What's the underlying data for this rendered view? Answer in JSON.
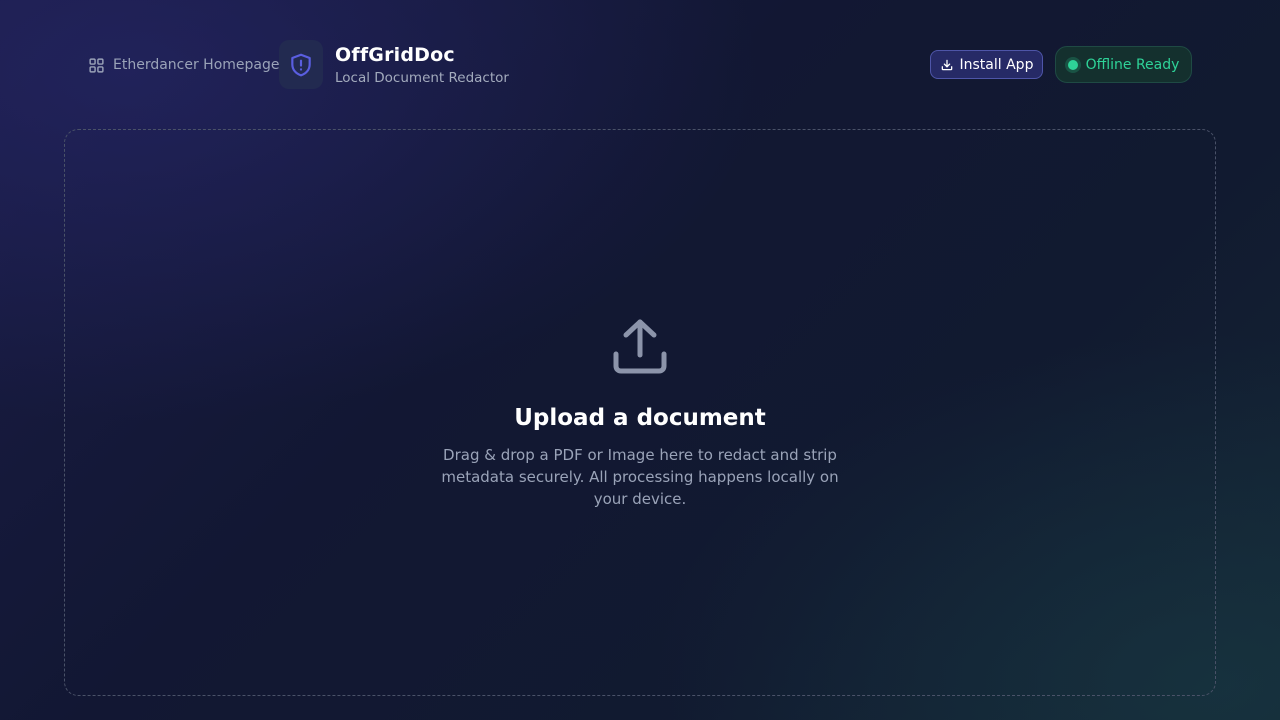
{
  "header": {
    "home_link_label": "Etherdancer Homepage",
    "brand_title": "OffGridDoc",
    "brand_subtitle": "Local Document Redactor",
    "install_label": "Install App",
    "status_label": "Offline Ready"
  },
  "upload": {
    "title": "Upload a document",
    "description": "Drag & drop a PDF or Image here to redact and strip metadata securely. All processing happens locally on your device."
  },
  "icons": {
    "home": "grid-icon",
    "brand": "shield-alert-icon",
    "install": "download-icon",
    "upload": "upload-icon"
  },
  "colors": {
    "accent": "#4e55a8",
    "status_green": "#2ed398",
    "brand_shield": "#5a5ee0"
  }
}
